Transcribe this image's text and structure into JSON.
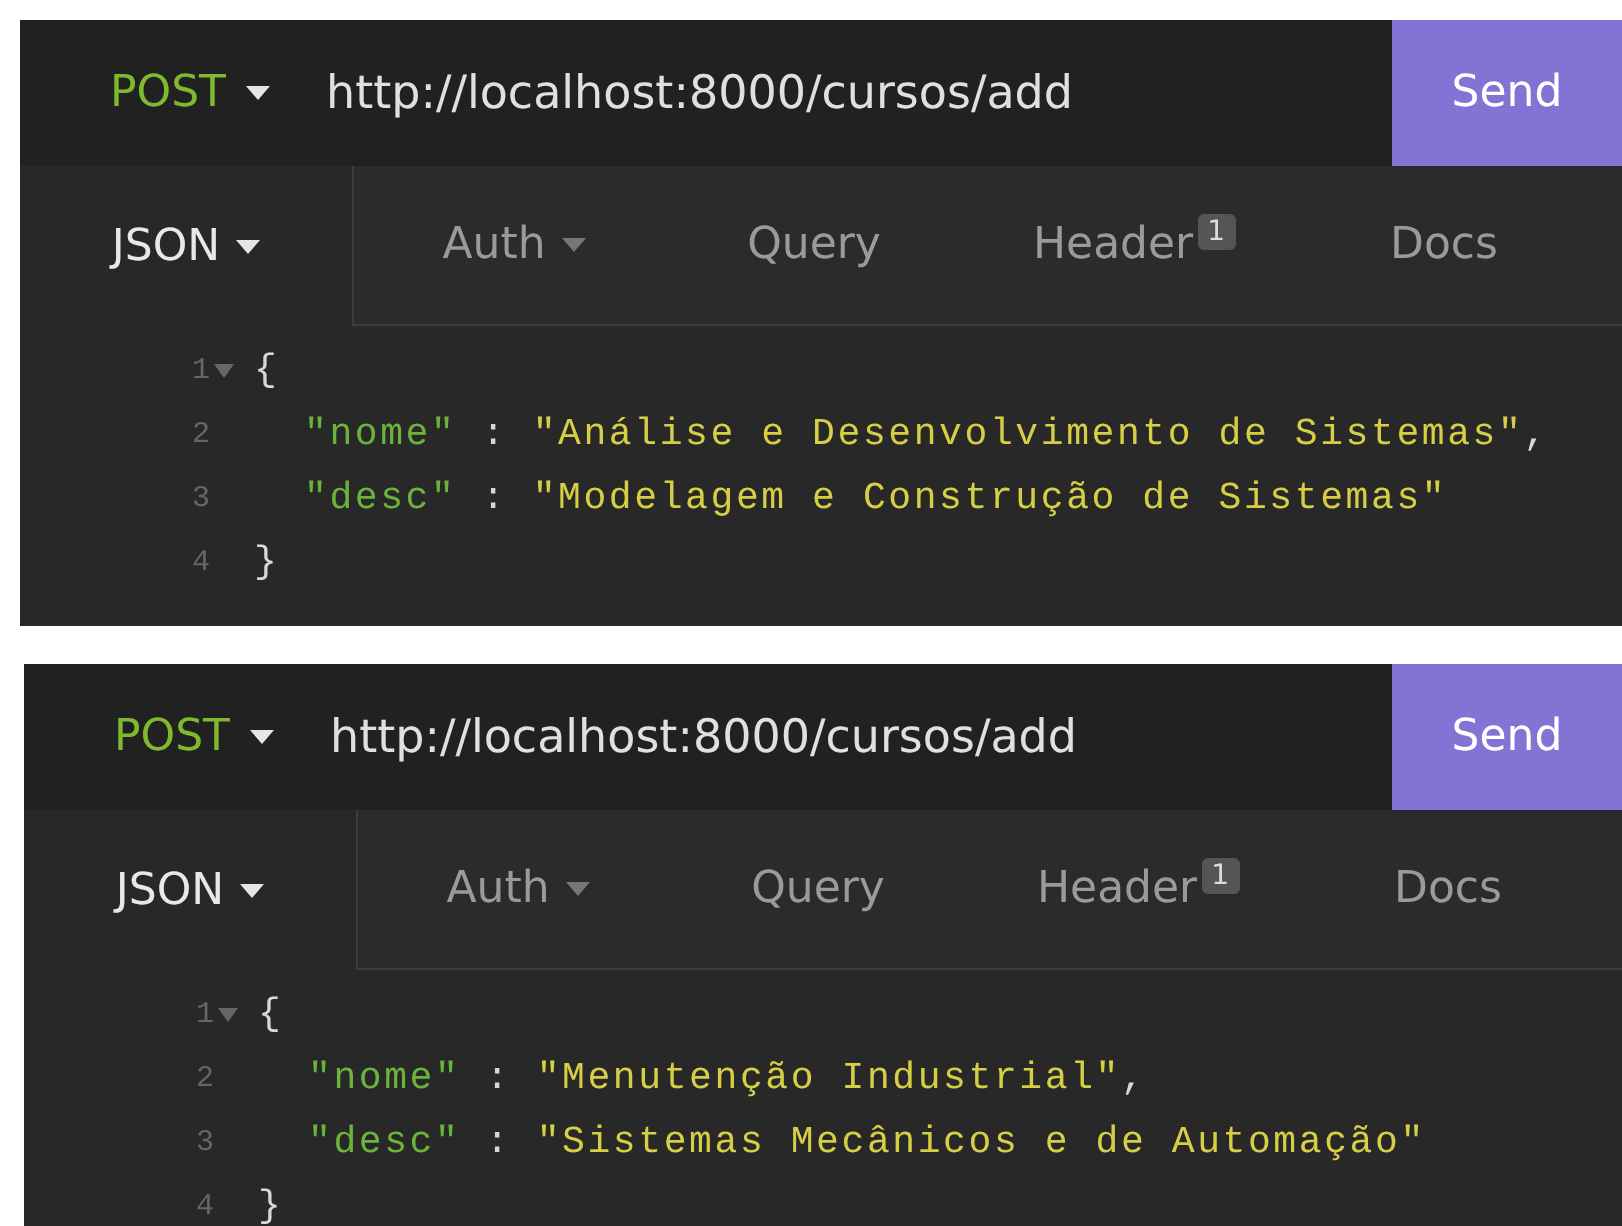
{
  "panels": [
    {
      "method": "POST",
      "url": "http://localhost:8000/cursos/add",
      "send": "Send",
      "tabs": [
        {
          "label": "JSON",
          "selected": true,
          "dropdown": true
        },
        {
          "label": "Auth",
          "selected": false,
          "dropdown": true
        },
        {
          "label": "Query",
          "selected": false,
          "dropdown": false
        },
        {
          "label": "Header",
          "selected": false,
          "dropdown": false,
          "badge": "1"
        },
        {
          "label": "Docs",
          "selected": false,
          "dropdown": false
        }
      ],
      "code": [
        {
          "number": "1",
          "fold": true,
          "tokens": [
            {
              "kind": "punct",
              "text": "{"
            }
          ],
          "children": [
            {
              "number": "2",
              "fold": false,
              "tokens": [
                {
                  "kind": "key",
                  "text": "\"nome\""
                },
                {
                  "kind": "punct",
                  "text": " : "
                },
                {
                  "kind": "string",
                  "text": "\"Análise e Desenvolvimento de Sistemas\""
                },
                {
                  "kind": "punct",
                  "text": ","
                }
              ]
            },
            {
              "number": "3",
              "fold": false,
              "tokens": [
                {
                  "kind": "key",
                  "text": "\"desc\""
                },
                {
                  "kind": "punct",
                  "text": " : "
                },
                {
                  "kind": "string",
                  "text": "\"Modelagem e Construção de Sistemas\""
                }
              ]
            }
          ]
        },
        {
          "number": "4",
          "fold": false,
          "tokens": [
            {
              "kind": "punct",
              "text": "}"
            }
          ]
        }
      ]
    },
    {
      "method": "POST",
      "url": "http://localhost:8000/cursos/add",
      "send": "Send",
      "tabs": [
        {
          "label": "JSON",
          "selected": true,
          "dropdown": true
        },
        {
          "label": "Auth",
          "selected": false,
          "dropdown": true
        },
        {
          "label": "Query",
          "selected": false,
          "dropdown": false
        },
        {
          "label": "Header",
          "selected": false,
          "dropdown": false,
          "badge": "1"
        },
        {
          "label": "Docs",
          "selected": false,
          "dropdown": false
        }
      ],
      "code": [
        {
          "number": "1",
          "fold": true,
          "tokens": [
            {
              "kind": "punct",
              "text": "{"
            }
          ],
          "children": [
            {
              "number": "2",
              "fold": false,
              "tokens": [
                {
                  "kind": "key",
                  "text": "\"nome\""
                },
                {
                  "kind": "punct",
                  "text": " : "
                },
                {
                  "kind": "string",
                  "text": "\"Menutenção Industrial\""
                },
                {
                  "kind": "punct",
                  "text": ","
                }
              ]
            },
            {
              "number": "3",
              "fold": false,
              "tokens": [
                {
                  "kind": "key",
                  "text": "\"desc\""
                },
                {
                  "kind": "punct",
                  "text": " : "
                },
                {
                  "kind": "string",
                  "text": "\"Sistemas Mecânicos e de Automação\""
                }
              ]
            }
          ]
        },
        {
          "number": "4",
          "fold": false,
          "tokens": [
            {
              "kind": "punct",
              "text": "}"
            }
          ]
        }
      ]
    }
  ]
}
